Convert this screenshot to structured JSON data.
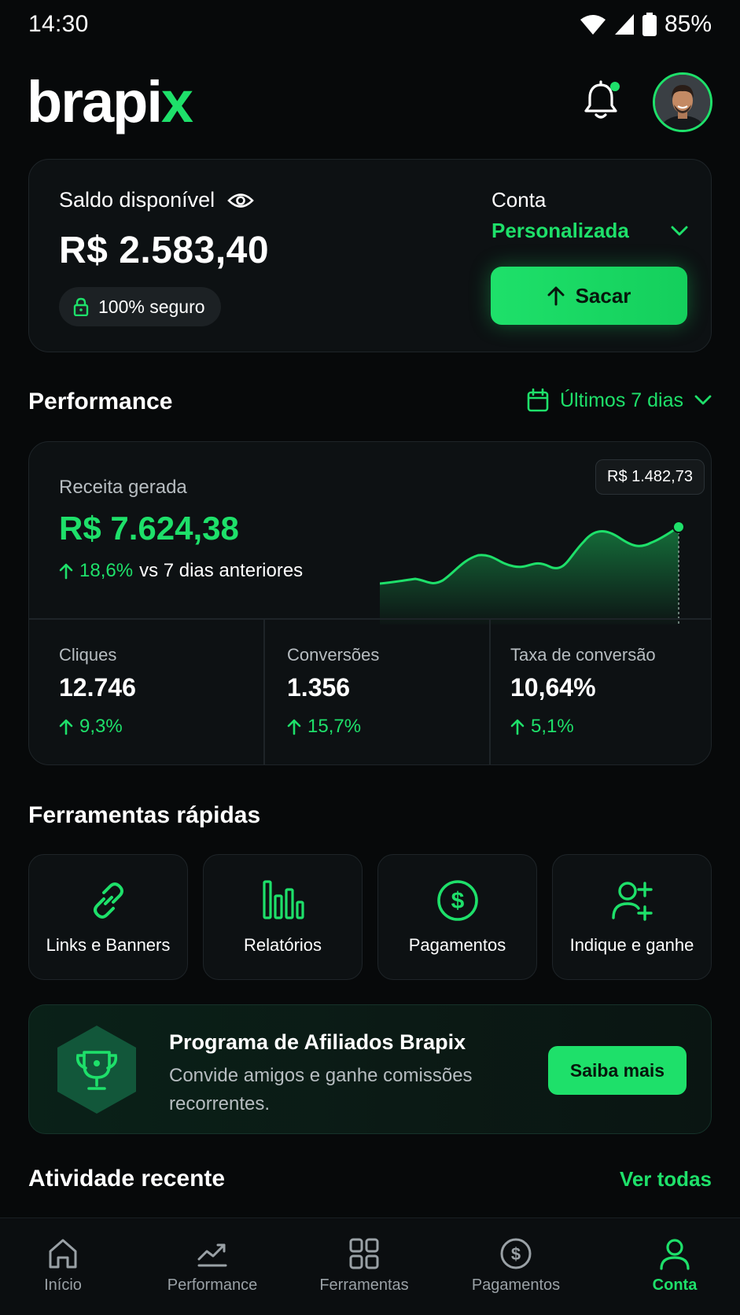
{
  "status_bar": {
    "time": "14:30",
    "battery": "85%"
  },
  "header": {
    "logo_main": "brapi",
    "logo_accent": "x"
  },
  "balance": {
    "label": "Saldo disponível",
    "value": "R$ 2.583,40",
    "secure_label": "100% seguro",
    "account_label": "Conta",
    "account_type": "Personalizada",
    "withdraw_label": "Sacar"
  },
  "performance": {
    "title": "Performance",
    "period": "Últimos 7 dias",
    "revenue_label": "Receita gerada",
    "revenue_value": "R$ 7.624,38",
    "revenue_delta": "18,6%",
    "revenue_delta_suffix": "vs 7 dias anteriores",
    "tooltip": "R$ 1.482,73",
    "stats": [
      {
        "label": "Cliques",
        "value": "12.746",
        "delta": "9,3%"
      },
      {
        "label": "Conversões",
        "value": "1.356",
        "delta": "15,7%"
      },
      {
        "label": "Taxa de conversão",
        "value": "10,64%",
        "delta": "5,1%"
      }
    ]
  },
  "tools": {
    "title": "Ferramentas rápidas",
    "items": [
      {
        "label": "Links e Banners",
        "icon": "link-icon"
      },
      {
        "label": "Relatórios",
        "icon": "bar-chart-icon"
      },
      {
        "label": "Pagamentos",
        "icon": "dollar-circle-icon"
      },
      {
        "label": "Indique e ganhe",
        "icon": "user-plus-icon"
      }
    ]
  },
  "affiliate": {
    "title": "Programa de Afiliados Brapix",
    "description": "Convide amigos e ganhe comissões recorrentes.",
    "button": "Saiba mais"
  },
  "recent": {
    "title": "Atividade recente",
    "see_all": "Ver todas"
  },
  "nav": {
    "items": [
      {
        "label": "Início",
        "icon": "home-icon"
      },
      {
        "label": "Performance",
        "icon": "trend-icon"
      },
      {
        "label": "Ferramentas",
        "icon": "grid-icon"
      },
      {
        "label": "Pagamentos",
        "icon": "dollar-circle-icon"
      },
      {
        "label": "Conta",
        "icon": "user-icon"
      }
    ],
    "active": "Conta"
  },
  "colors": {
    "accent": "#1ee06a",
    "background": "#07090a",
    "card": "#0d1113"
  }
}
